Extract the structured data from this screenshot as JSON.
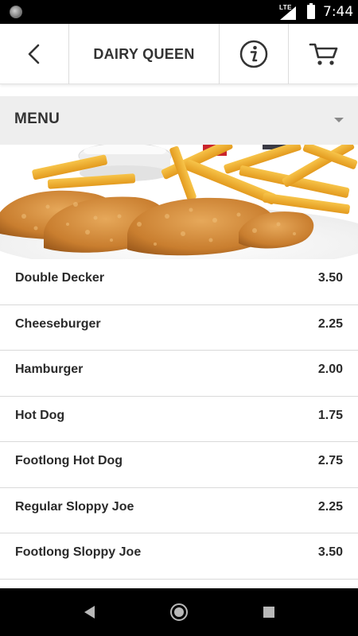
{
  "status_bar": {
    "network": "LTE",
    "time": "7:44"
  },
  "header": {
    "title": "DAIRY QUEEN",
    "back_icon": "chevron-left-icon",
    "info_icon": "info-circle-icon",
    "cart_icon": "cart-icon"
  },
  "menu_section": {
    "label": "MENU",
    "dropdown_icon": "caret-down-icon"
  },
  "banner": {
    "image": "chicken-strips-and-fries-photo"
  },
  "menu_items": [
    {
      "name": "Double Decker",
      "price": "3.50"
    },
    {
      "name": "Cheeseburger",
      "price": "2.25"
    },
    {
      "name": "Hamburger",
      "price": "2.00"
    },
    {
      "name": "Hot Dog",
      "price": "1.75"
    },
    {
      "name": "Footlong Hot Dog",
      "price": "2.75"
    },
    {
      "name": "Regular Sloppy Joe",
      "price": "2.25"
    },
    {
      "name": "Footlong Sloppy Joe",
      "price": "3.50"
    }
  ],
  "nav_bar": {
    "back_icon": "nav-back-icon",
    "home_icon": "nav-home-icon",
    "recents_icon": "nav-recents-icon"
  }
}
